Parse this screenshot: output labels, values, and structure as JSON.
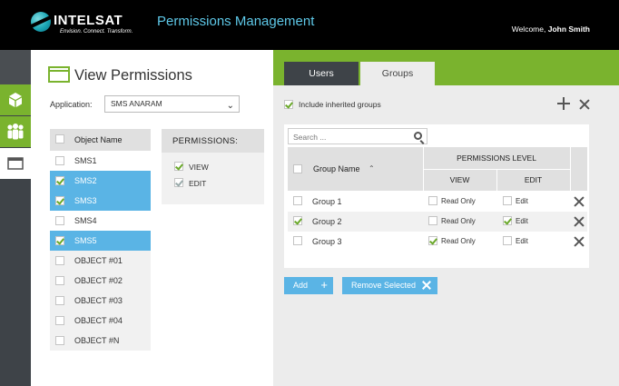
{
  "header": {
    "brand": "INTELSAT",
    "tagline": "Envision. Connect. Transform.",
    "app_title": "Permissions Management",
    "welcome_prefix": "Welcome,",
    "user_name": "John Smith"
  },
  "left_panel": {
    "title": "View Permissions",
    "application_label": "Application:",
    "application_value": "SMS ANARAM",
    "object_column": "Object Name",
    "objects": [
      {
        "name": "SMS1",
        "checked": false,
        "selected": false
      },
      {
        "name": "SMS2",
        "checked": true,
        "selected": true
      },
      {
        "name": "SMS3",
        "checked": true,
        "selected": true
      },
      {
        "name": "SMS4",
        "checked": false,
        "selected": false
      },
      {
        "name": "SMS5",
        "checked": true,
        "selected": true
      },
      {
        "name": "OBJECT #01",
        "checked": false,
        "selected": false
      },
      {
        "name": "OBJECT #02",
        "checked": false,
        "selected": false
      },
      {
        "name": "OBJECT #03",
        "checked": false,
        "selected": false
      },
      {
        "name": "OBJECT #04",
        "checked": false,
        "selected": false
      },
      {
        "name": "OBJECT #N",
        "checked": false,
        "selected": false
      }
    ],
    "permissions_heading": "PERMISSIONS:",
    "permissions": [
      {
        "label": "VIEW",
        "checked": true
      },
      {
        "label": "EDIT",
        "checked": true
      }
    ]
  },
  "right_panel": {
    "tabs": [
      "Users",
      "Groups"
    ],
    "active_tab": "Groups",
    "include_inherited_label": "Include inherited groups",
    "search_placeholder": "Search ...",
    "columns": {
      "group_name": "Group Name",
      "permissions_level": "PERMISSIONS LEVEL",
      "view": "VIEW",
      "edit": "EDIT"
    },
    "groups": [
      {
        "name": "Group 1",
        "selected": false,
        "view_label": "Read Only",
        "view": false,
        "edit_label": "Edit",
        "edit": false
      },
      {
        "name": "Group 2",
        "selected": true,
        "view_label": "Read Only",
        "view": false,
        "edit_label": "Edit",
        "edit": true
      },
      {
        "name": "Group 3",
        "selected": false,
        "view_label": "Read Only",
        "view": true,
        "edit_label": "Edit",
        "edit": false
      }
    ],
    "add_button": "Add",
    "remove_button": "Remove Selected"
  },
  "colors": {
    "accent_green": "#7ab32e",
    "accent_blue": "#5ab4e5",
    "title_cyan": "#5ec8e8"
  }
}
